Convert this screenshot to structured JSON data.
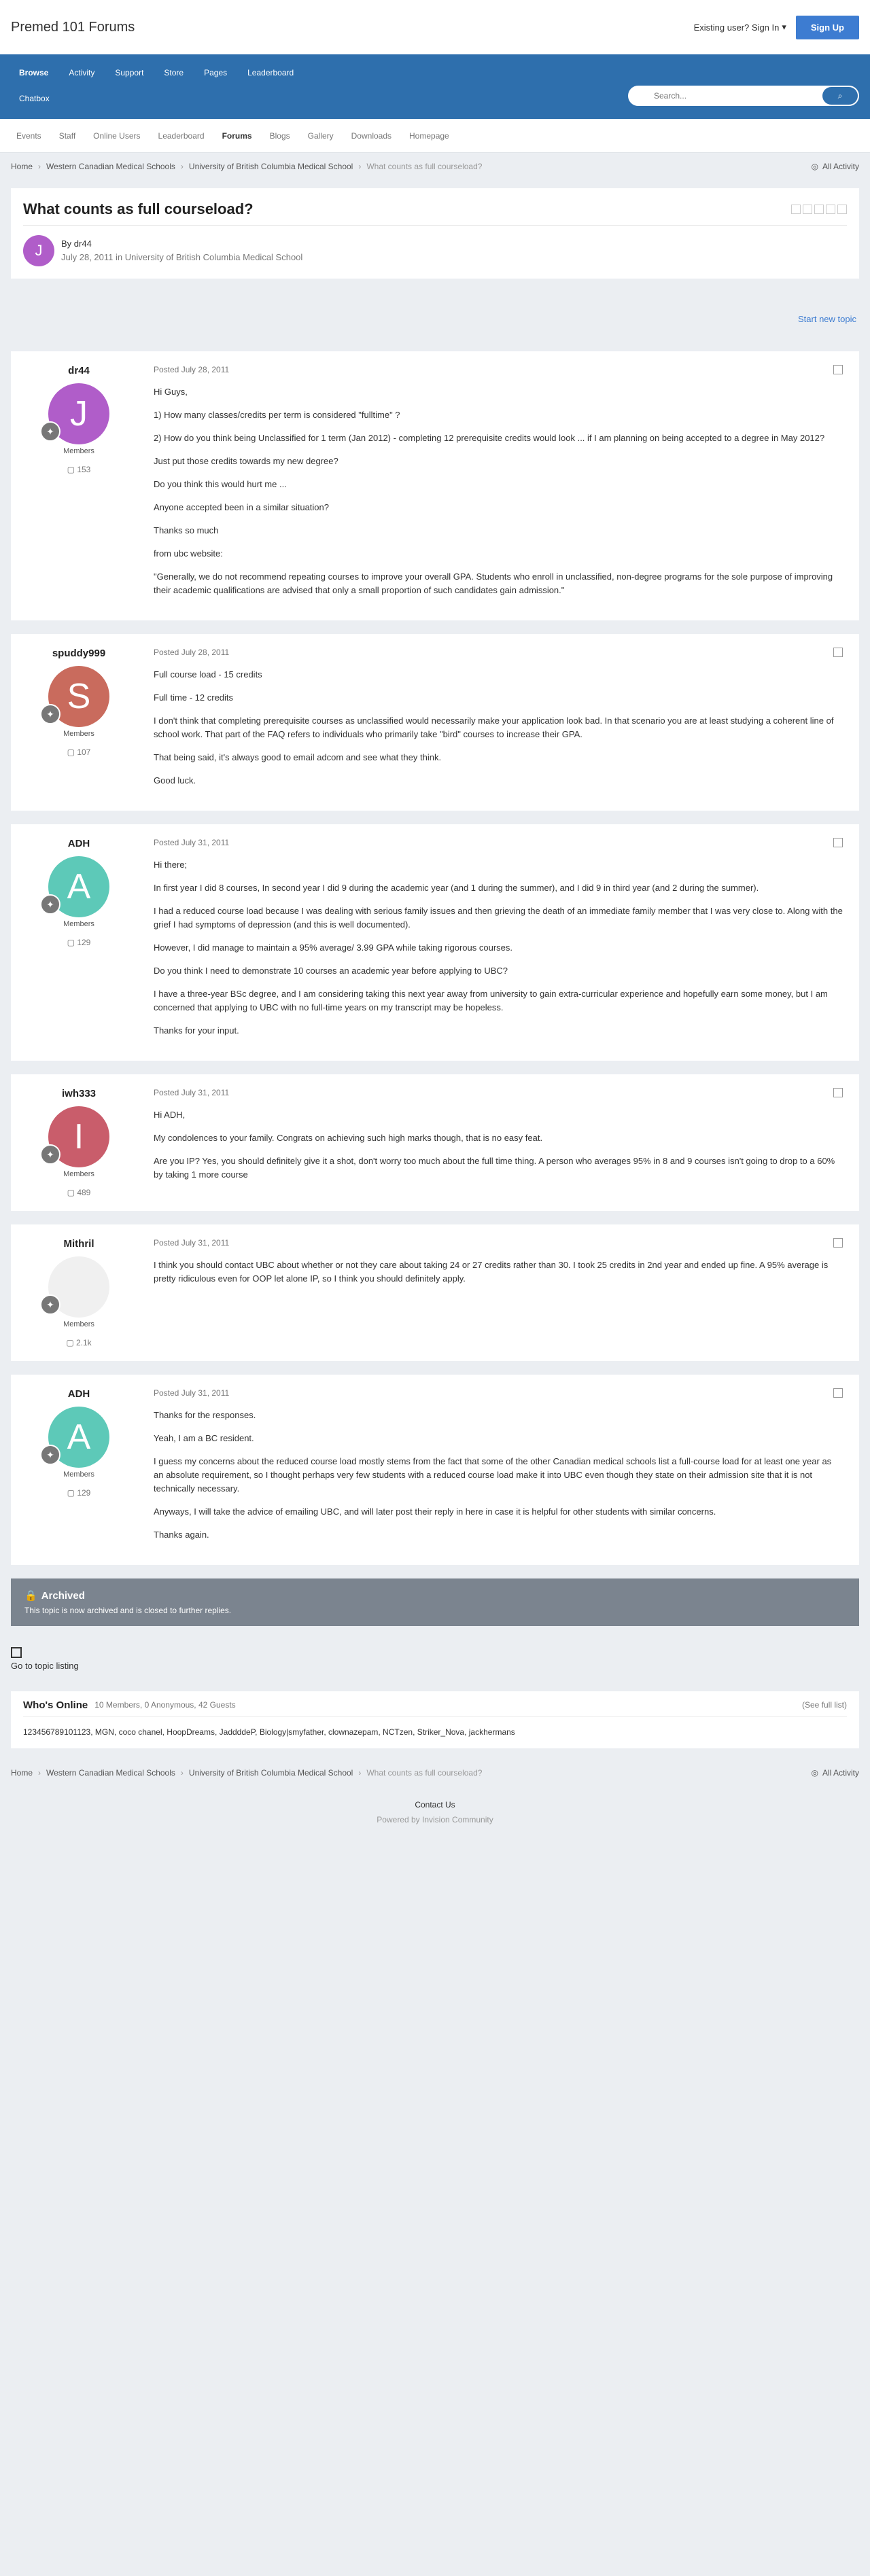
{
  "header": {
    "logo": "Premed 101 Forums",
    "signin": "Existing user? Sign In",
    "signup": "Sign Up"
  },
  "nav": {
    "browse": "Browse",
    "activity": "Activity",
    "support": "Support",
    "store": "Store",
    "pages": "Pages",
    "leaderboard": "Leaderboard",
    "chatbox": "Chatbox"
  },
  "search": {
    "placeholder": "Search..."
  },
  "subnav": {
    "events": "Events",
    "staff": "Staff",
    "online_users": "Online Users",
    "leaderboard": "Leaderboard",
    "forums": "Forums",
    "blogs": "Blogs",
    "gallery": "Gallery",
    "downloads": "Downloads",
    "homepage": "Homepage"
  },
  "breadcrumb": {
    "home": "Home",
    "western": "Western Canadian Medical Schools",
    "ubc": "University of British Columbia Medical School",
    "topic": "What counts as full courseload?",
    "all_activity": "All Activity"
  },
  "topic": {
    "title": "What counts as full courseload?",
    "by": "By",
    "author": "dr44",
    "date": "July 28, 2011",
    "in": "in",
    "forum": "University of British Columbia Medical School",
    "avatar_letter": "J",
    "start_new": "Start new topic"
  },
  "posts": [
    {
      "username": "dr44",
      "avatar_letter": "J",
      "group": "Members",
      "count": "153",
      "date": "Posted July 28, 2011",
      "paragraphs": [
        "Hi Guys,",
        "1) How many classes/credits per term is considered \"fulltime\" ?",
        "2) How do you think being Unclassified for 1 term (Jan 2012) - completing 12 prerequisite credits would look ... if I am planning on being accepted to a degree in May 2012?",
        "Just put those credits towards my new degree?",
        "Do you think this would hurt me ...",
        "Anyone accepted been in a similar situation?",
        "Thanks so much",
        "from ubc website:",
        "\"Generally, we do not recommend repeating courses to improve your overall GPA. Students who enroll in unclassified, non-degree programs for the sole purpose of improving their academic qualifications are advised that only a small proportion of such candidates gain admission.\""
      ]
    },
    {
      "username": "spuddy999",
      "avatar_letter": "S",
      "group": "Members",
      "count": "107",
      "date": "Posted July 28, 2011",
      "paragraphs": [
        "Full course load - 15 credits",
        "Full time - 12 credits",
        "I don't think that completing prerequisite courses as unclassified would necessarily make your application look bad. In that scenario you are at least studying a coherent line of school work. That part of the FAQ refers to individuals who primarily take \"bird\" courses to increase their GPA.",
        "That being said, it's always good to email adcom and see what they think.",
        "Good luck."
      ]
    },
    {
      "username": "ADH",
      "avatar_letter": "A",
      "group": "Members",
      "count": "129",
      "date": "Posted July 31, 2011",
      "paragraphs": [
        "Hi there;",
        "In first year I did 8 courses, In second year I did 9 during the academic year (and 1 during the summer), and I did 9 in third year (and 2 during the summer).",
        "I had a reduced course load because I was dealing with serious family issues and then grieving the death of an immediate family member that I was very close to. Along with the grief I had symptoms of depression (and this is well documented).",
        "However, I did manage to maintain a 95% average/ 3.99 GPA while taking rigorous courses.",
        "Do you think I need to demonstrate 10 courses an academic year before applying to UBC?",
        "I have a three-year BSc degree, and I am considering taking this next year away from university to gain extra-curricular experience and hopefully earn some money, but I am concerned that applying to UBC with no full-time years on my transcript may be hopeless.",
        "Thanks for your input."
      ]
    },
    {
      "username": "iwh333",
      "avatar_letter": "I",
      "group": "Members",
      "count": "489",
      "date": "Posted July 31, 2011",
      "paragraphs": [
        "Hi ADH,",
        "My condolences to your family. Congrats on achieving such high marks though, that is no easy feat.",
        "Are you IP? Yes, you should definitely give it a shot, don't worry too much about the full time thing. A person who averages 95% in 8 and 9 courses isn't going to drop to a 60% by taking 1 more course"
      ]
    },
    {
      "username": "Mithril",
      "avatar_letter": "",
      "group": "Members",
      "count": "2.1k",
      "date": "Posted July 31, 2011",
      "paragraphs": [
        "I think you should contact UBC about whether or not they care about taking 24 or 27 credits rather than 30. I took 25 credits in 2nd year and ended up fine. A 95% average is pretty ridiculous even for OOP let alone IP, so I think you should definitely apply."
      ]
    },
    {
      "username": "ADH",
      "avatar_letter": "A",
      "group": "Members",
      "count": "129",
      "date": "Posted July 31, 2011",
      "paragraphs": [
        "Thanks for the responses.",
        "Yeah, I am a BC resident.",
        "I guess my concerns about the reduced course load mostly stems from the fact that some of the other Canadian medical schools list a full-course load for at least one year as an absolute requirement, so I thought perhaps very few students with a reduced course load make it into UBC even though they state on their admission site that it is not technically necessary.",
        "Anyways, I will take the advice of emailing UBC, and will later post their reply in here in case it is helpful for other students with similar concerns.",
        "Thanks again."
      ]
    }
  ],
  "archived": {
    "title": "Archived",
    "text": "This topic is now archived and is closed to further replies."
  },
  "go_listing": "Go to topic listing",
  "online": {
    "title": "Who's Online",
    "count": "10 Members, 0 Anonymous, 42 Guests",
    "see_full": "(See full list)",
    "users": [
      "123456789101123",
      "MGN",
      "coco chanel",
      "HoopDreams",
      "JaddddeP",
      "Biology|smyfather",
      "clownazepam",
      "NCTzen",
      "Striker_Nova",
      "jackhermans"
    ]
  },
  "footer": {
    "contact": "Contact Us",
    "powered": "Powered by Invision Community"
  },
  "colors": {
    "avatar_j": "#b05dc9",
    "avatar_s": "#c96b5d",
    "avatar_a": "#5dc9b8",
    "avatar_i": "#c95d6b",
    "nav_blue": "#2e6fad"
  }
}
